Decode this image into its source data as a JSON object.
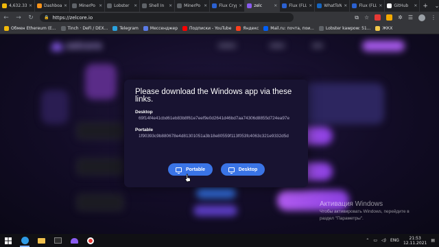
{
  "browser": {
    "tabs": [
      {
        "label": "4,632.33",
        "color": "#f0b90b"
      },
      {
        "label": "Dashboa",
        "color": "#f7931a"
      },
      {
        "label": "MinerPo",
        "color": "#5f6368"
      },
      {
        "label": "Lobster",
        "color": "#5f6368"
      },
      {
        "label": "Shell In",
        "color": "#5f6368"
      },
      {
        "label": "MinerPo",
        "color": "#5f6368"
      },
      {
        "label": "Flux Cryp",
        "color": "#2b61d1"
      },
      {
        "label": "zelc",
        "color": "#8a5cf0"
      },
      {
        "label": "Flux (FLU",
        "color": "#2b61d1"
      },
      {
        "label": "WhatToN",
        "color": "#1565c0"
      },
      {
        "label": "Flux (FLU",
        "color": "#2b61d1"
      },
      {
        "label": "GitHub",
        "color": "#ffffff"
      }
    ],
    "active_tab": 7,
    "url": "https://zelcore.io",
    "bookmarks": [
      {
        "label": "Обмен Ethereum (E...",
        "color": "#f0b90b"
      },
      {
        "label": "Tinch · DeFi / DEX...",
        "color": "#5f6368"
      },
      {
        "label": "Telegram",
        "color": "#2aa3e0"
      },
      {
        "label": "Мессенджер",
        "color": "#5a7be8"
      },
      {
        "label": "Подписки - YouTube",
        "color": "#ff0000"
      },
      {
        "label": "Яндекс",
        "color": "#fc3f1d"
      },
      {
        "label": "Mail.ru: почта, пои...",
        "color": "#005ff9"
      },
      {
        "label": "Lobster kawpow: 51...",
        "color": "#5f6368"
      },
      {
        "label": "ЖКХ",
        "color": "#f2c94c"
      }
    ]
  },
  "site": {
    "logo_text": "zelcore"
  },
  "modal": {
    "title": "Please download the Windows app via these links.",
    "desktop_label": "Desktop",
    "desktop_hash": "69f14f4e41cbd61eb83b8f61e7eef9e0d2641d46bd7aa74306d8855d724ea97e",
    "portable_label": "Portable",
    "portable_hash": "1f90393c9b880678e4d81301051a3b18e80559f113f053fc4063c321e9332d5d",
    "btn_portable": "Portable",
    "btn_desktop": "Desktop"
  },
  "activation": {
    "title": "Активация Windows",
    "subtitle_line1": "Чтобы активировать Windows, перейдите в",
    "subtitle_line2": "раздел \"Параметры\"."
  },
  "taskbar": {
    "lang": "ENG",
    "time": "21:53",
    "date": "12.11.2021"
  }
}
